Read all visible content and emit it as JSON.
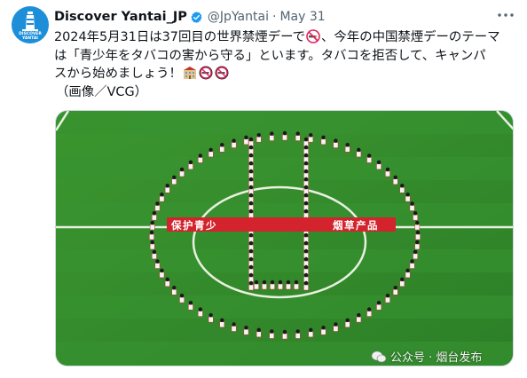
{
  "author": {
    "display_name": "Discover Yantai_JP",
    "handle": "@JpYantai",
    "separator": "·",
    "date": "May 31",
    "avatar_brand_line1": "DISCOVER",
    "avatar_brand_line2": "YANTAI"
  },
  "tweet": {
    "line1": "2024年5月31日は37回目の世界禁煙デーで",
    "line1_after_emoji": "、今年の中国禁煙デーのテーマ",
    "line2": "は「青少年をタバコの害から守る」といます。タバコを拒否して、キャンパ",
    "line3": "スから始めましょう！",
    "line4": "（画像／VCG）",
    "emojis": [
      "no-smoking-emoji",
      "school-emoji",
      "no-smoking-emoji",
      "no-smoking-emoji"
    ]
  },
  "media": {
    "banner_text_left": "保护青少",
    "banner_text_right": "烟草产品",
    "watermark": "公众号 · 烟台发布"
  },
  "colors": {
    "field_green": "#2f8a2a",
    "field_light": "#3a9a33",
    "banner_red": "#d3232c",
    "verified_blue": "#1d9bf0",
    "avatar_blue": "#1d8fd8"
  }
}
